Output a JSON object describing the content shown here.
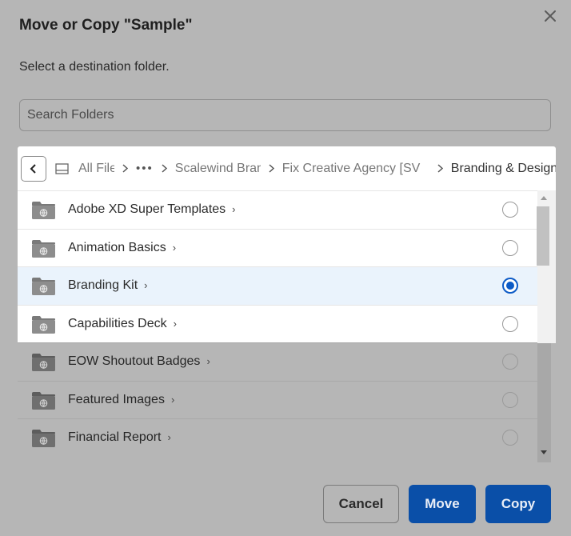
{
  "dialog": {
    "title": "Move or Copy \"Sample\"",
    "subtitle": "Select a destination folder.",
    "close_icon": "close-icon"
  },
  "search": {
    "placeholder": "Search Folders",
    "value": ""
  },
  "breadcrumb": {
    "back_icon": "chevron-left-icon",
    "drive_icon": "drive-icon",
    "items": [
      "All Files",
      "•••",
      "Scalewind Brand",
      "Fix Creative Agency [SV",
      "Branding & Design"
    ]
  },
  "folders": [
    {
      "name": "Adobe XD Super Templates",
      "chevron": "›",
      "selected": false
    },
    {
      "name": "Animation Basics",
      "chevron": "›",
      "selected": false
    },
    {
      "name": "Branding Kit",
      "chevron": "›",
      "selected": true
    },
    {
      "name": "Capabilities Deck",
      "chevron": "›",
      "selected": false
    },
    {
      "name": "EOW Shoutout Badges",
      "chevron": "›",
      "selected": false
    },
    {
      "name": "Featured Images",
      "chevron": "›",
      "selected": false
    },
    {
      "name": "Financial Report",
      "chevron": "›",
      "selected": false
    }
  ],
  "buttons": {
    "cancel": "Cancel",
    "move": "Move",
    "copy": "Copy"
  },
  "colors": {
    "accent": "#0a4fa8",
    "radio_selected": "#0d5bc6",
    "selected_row": "#eaf3fc",
    "overlay": "#b6b6b6"
  }
}
